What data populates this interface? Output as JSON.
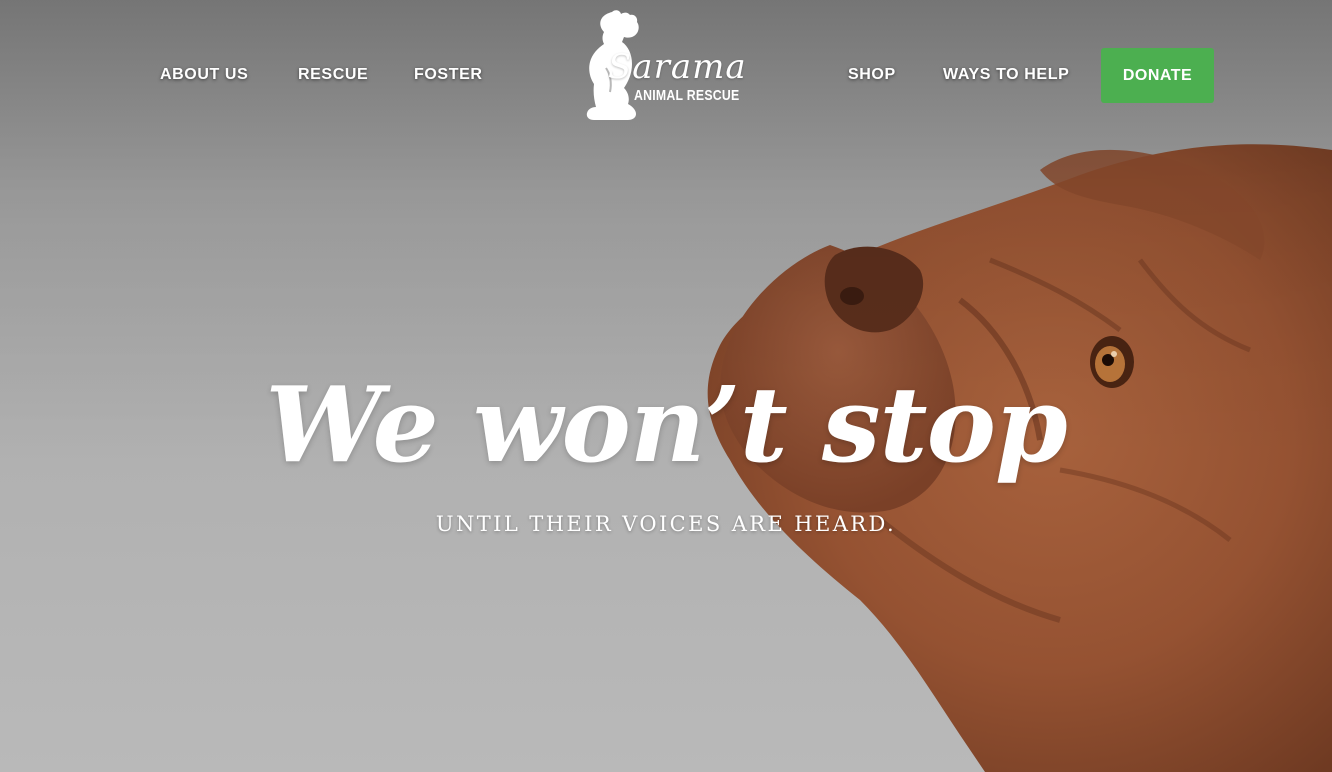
{
  "nav": {
    "left_items": [
      {
        "label": "ABOUT US"
      },
      {
        "label": "RESCUE"
      },
      {
        "label": "FOSTER"
      }
    ],
    "right_items": [
      {
        "label": "SHOP"
      },
      {
        "label": "WAYS TO HELP"
      }
    ],
    "donate_label": "DONATE",
    "donate_color": "#4caf50"
  },
  "logo": {
    "name": "Sarama",
    "subtitle": "ANIMAL RESCUE",
    "icon": "sitting-dog-silhouette"
  },
  "hero": {
    "headline": "We won’t stop",
    "subheadline": "UNTIL THEIR VOICES ARE HEARD.",
    "image": "dogue-de-bordeaux-photo"
  }
}
